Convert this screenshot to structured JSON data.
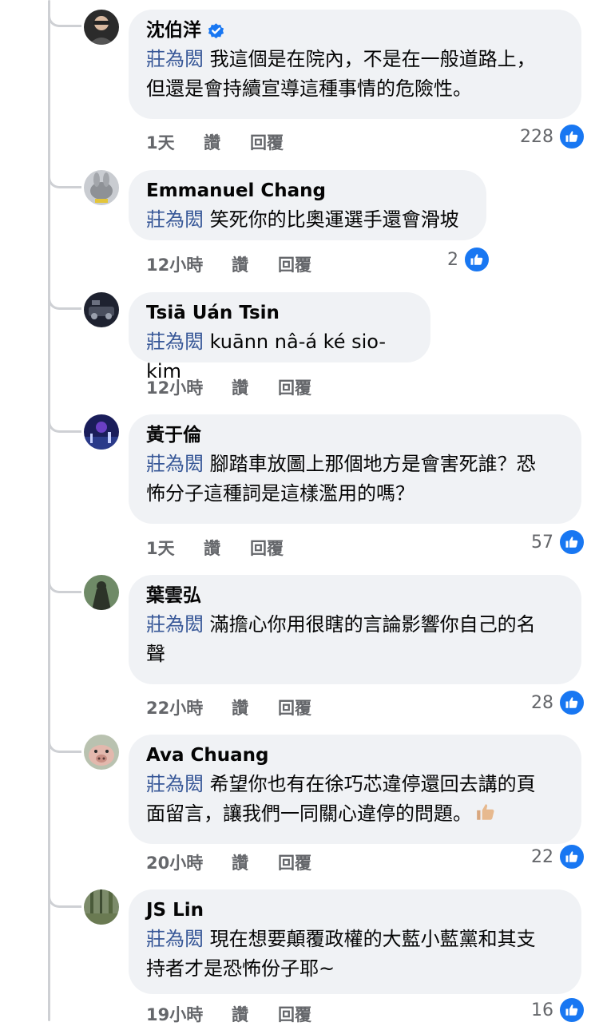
{
  "comments": [
    {
      "author": "沈伯洋",
      "verified": true,
      "mention": "莊為閎",
      "lines": [
        "我這個是在院內，不是在一般道路上，",
        "但還是會持續宣導這種事情的危險性。"
      ],
      "time": "1天",
      "like": "讚",
      "reply": "回覆",
      "reactions": "228",
      "avatar_color": "#3a3a3a"
    },
    {
      "author": "Emmanuel Chang",
      "verified": false,
      "mention": "莊為閎",
      "lines": [
        "笑死你的比奧運選手還會滑坡"
      ],
      "time": "12小時",
      "like": "讚",
      "reply": "回覆",
      "reactions": "2",
      "avatar_color": "#9a9ea3"
    },
    {
      "author": "Tsiā Uán Tsin",
      "verified": false,
      "mention": "莊為閎",
      "lines": [
        "kuānn nâ-á ké sio-kim"
      ],
      "time": "12小時",
      "like": "讚",
      "reply": "回覆",
      "reactions": "",
      "avatar_color": "#2b2f3a"
    },
    {
      "author": "黃于倫",
      "verified": false,
      "mention": "莊為閎",
      "lines": [
        "腳踏車放圖上那個地方是會害死誰？恐",
        "怖分子這種詞是這樣濫用的嗎？"
      ],
      "time": "1天",
      "like": "讚",
      "reply": "回覆",
      "reactions": "57",
      "avatar_color": "#3b3fa0"
    },
    {
      "author": "葉雲弘",
      "verified": false,
      "mention": "莊為閎",
      "lines": [
        "滿擔心你用很瞎的言論影響你自己的名",
        "聲"
      ],
      "time": "22小時",
      "like": "讚",
      "reply": "回覆",
      "reactions": "28",
      "avatar_color": "#4f6b4a"
    },
    {
      "author": "Ava Chuang",
      "verified": false,
      "mention": "莊為閎",
      "lines": [
        "希望你也有在徐巧芯違停還回去講的頁",
        "面留言，讓我們一同關心違停的問題。"
      ],
      "time": "20小時",
      "like": "讚",
      "reply": "回覆",
      "reactions": "22",
      "avatar_color": "#c79a8f"
    },
    {
      "author": "JS Lin",
      "verified": false,
      "mention": "莊為閎",
      "lines": [
        "現在想要顛覆政權的大藍小藍黨和其支",
        "持者才是恐怖份子耶~"
      ],
      "time": "19小時",
      "like": "讚",
      "reply": "回覆",
      "reactions": "16",
      "avatar_color": "#5d6b4c"
    }
  ],
  "colors": {
    "mention": "#385898",
    "meta_text": "#65676b",
    "bubble_bg": "#f0f2f5",
    "like_blue": "#1877f2",
    "thread_line": "#ced0d4"
  }
}
